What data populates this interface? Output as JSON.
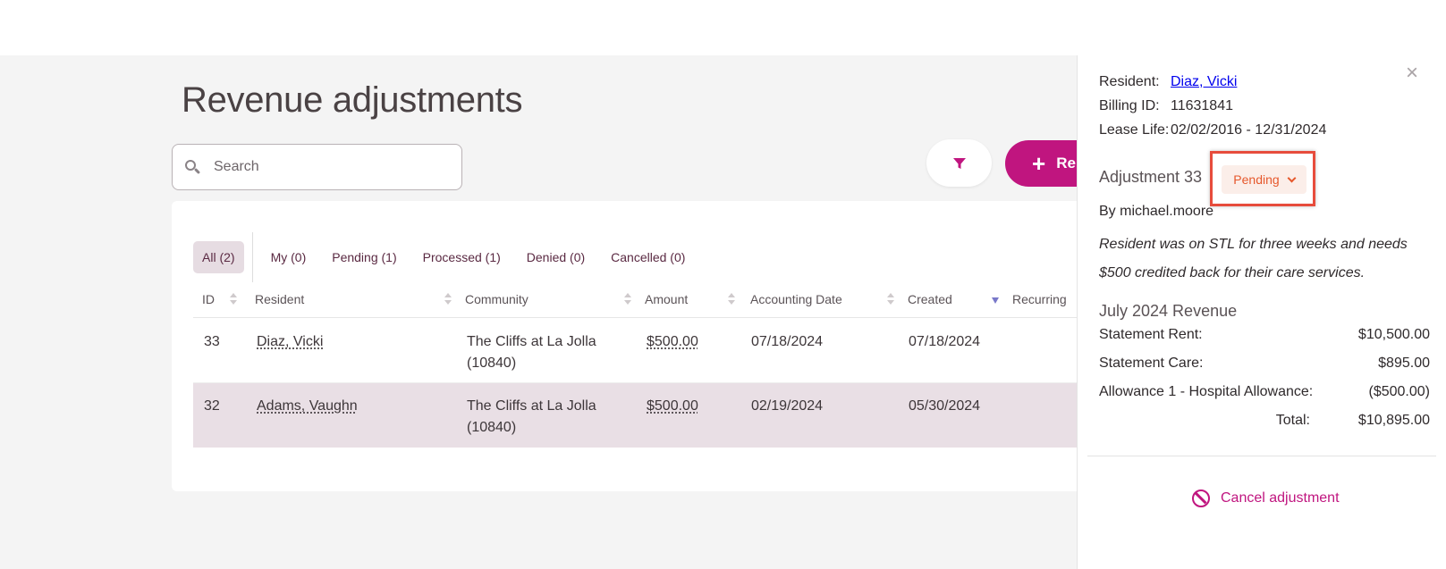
{
  "page": {
    "title": "Revenue adjustments"
  },
  "search": {
    "placeholder": "Search"
  },
  "toolbar": {
    "new_label": "Re"
  },
  "tabs": [
    {
      "label": "All (2)",
      "active": true
    },
    {
      "label": "My (0)"
    },
    {
      "label": "Pending (1)"
    },
    {
      "label": "Processed (1)"
    },
    {
      "label": "Denied (0)"
    },
    {
      "label": "Cancelled (0)"
    }
  ],
  "table": {
    "columns": [
      "ID",
      "Resident",
      "Community",
      "Amount",
      "Accounting Date",
      "Created",
      "Recurring"
    ],
    "rows": [
      {
        "id": "33",
        "resident": "Diaz, Vicki",
        "community_line1": "The Cliffs at La Jolla",
        "community_line2": "(10840)",
        "amount": "$500.00",
        "accounting_date": "07/18/2024",
        "created": "07/18/2024"
      },
      {
        "id": "32",
        "resident": "Adams, Vaughn",
        "community_line1": "The Cliffs at La Jolla",
        "community_line2": "(10840)",
        "amount": "$500.00",
        "accounting_date": "02/19/2024",
        "created": "05/30/2024"
      }
    ]
  },
  "panel": {
    "resident_label": "Resident:",
    "resident_value": "Diaz, Vicki",
    "billing_label": "Billing ID:",
    "billing_value": "11631841",
    "lease_label": "Lease Life:",
    "lease_value": "02/02/2016 - 12/31/2024",
    "adjustment_title": "Adjustment 33",
    "status": "Pending",
    "by_line": "By michael.moore",
    "note_line1": "Resident was on STL for three weeks and needs",
    "note_line2": "$500 credited back for their care services.",
    "revenue_title": "July 2024 Revenue",
    "items": [
      {
        "label": "Statement Rent:",
        "amount": "$10,500.00"
      },
      {
        "label": "Statement Care:",
        "amount": "$895.00"
      },
      {
        "label": "Allowance 1 - Hospital Allowance:",
        "amount": "($500.00)"
      }
    ],
    "total_label": "Total:",
    "total_amount": "$10,895.00",
    "cancel_label": "Cancel adjustment",
    "close_glyph": "×"
  },
  "colors": {
    "accent": "#c0157f",
    "status_orange": "#e6582c",
    "highlight_red": "#e74c3c",
    "selected_row": "#e9dfe5"
  }
}
